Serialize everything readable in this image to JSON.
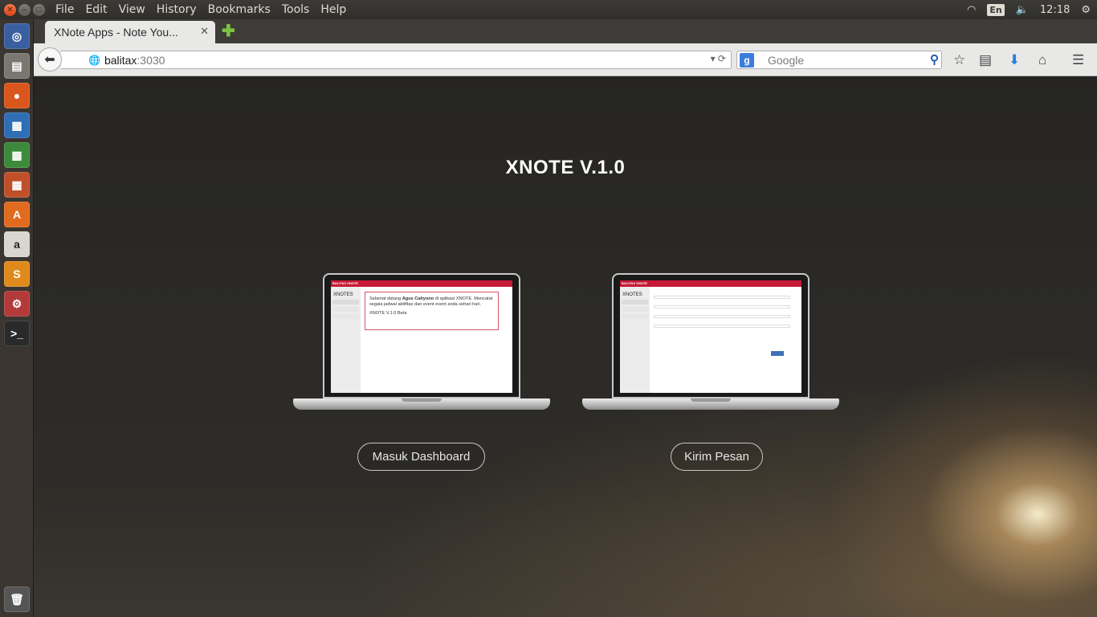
{
  "os_panel": {
    "menus": [
      "File",
      "Edit",
      "View",
      "History",
      "Bookmarks",
      "Tools",
      "Help"
    ],
    "lang": "En",
    "time": "12:18"
  },
  "browser": {
    "tab_title": "XNote Apps - Note You...",
    "url_host": "balitax",
    "url_port": ":3030",
    "search_placeholder": "Google"
  },
  "page": {
    "title": "XNOTE V.1.0",
    "buttons": {
      "dashboard": "Masuk Dashboard",
      "message": "Kirim Pesan"
    },
    "mock1": {
      "header": "BALITAX XNOTE",
      "logo": "XNOTES",
      "welcome_prefix": "Selamat datang ",
      "welcome_name": "Agus Cahyono",
      "welcome_suffix": " di aplikasi XNOTE. Mencatat segala jadwal aktifitas dan event event anda sehari hari.",
      "version": "XNOTE V.1.0 Beta"
    },
    "mock2": {
      "header": "BALITAX XNOTE",
      "logo": "XNOTES"
    }
  },
  "colors": {
    "accent_red": "#c61a36",
    "panel_bg": "#3c3b37"
  }
}
